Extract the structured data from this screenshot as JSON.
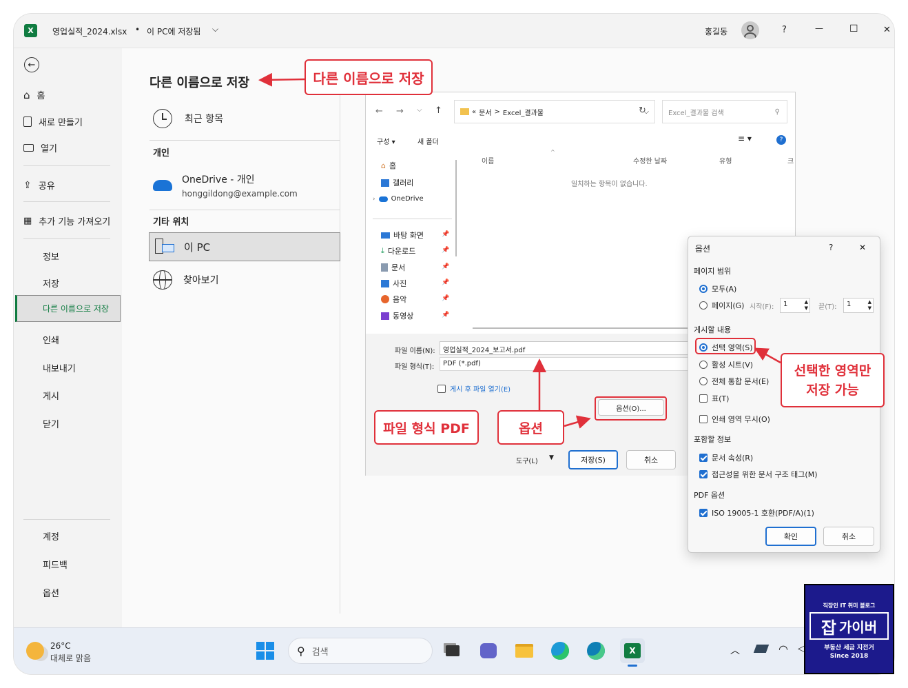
{
  "titlebar": {
    "filename": "영업실적_2024.xlsx",
    "bullet": "•",
    "save_location": "이 PC에 저장됨",
    "user": "홍길동",
    "help": "?",
    "minimize": "—",
    "maximize": "☐",
    "close": "✕"
  },
  "sidebar": {
    "items": [
      {
        "label": "홈"
      },
      {
        "label": "새로 만들기"
      },
      {
        "label": "열기"
      },
      {
        "label": "공유"
      },
      {
        "label": "추가 기능 가져오기"
      },
      {
        "label": "정보"
      },
      {
        "label": "저장"
      },
      {
        "label": "다른 이름으로 저장"
      },
      {
        "label": "인쇄"
      },
      {
        "label": "내보내기"
      },
      {
        "label": "게시"
      },
      {
        "label": "닫기"
      },
      {
        "label": "계정"
      },
      {
        "label": "피드백"
      },
      {
        "label": "옵션"
      }
    ]
  },
  "saveas": {
    "title": "다른 이름으로 저장",
    "recent": "최근 항목",
    "personal_header": "개인",
    "onedrive_name": "OneDrive - 개인",
    "onedrive_email": "honggildong@example.com",
    "other_header": "기타 위치",
    "this_pc": "이 PC",
    "browse": "찾아보기"
  },
  "dialog": {
    "path_prefix": "«",
    "path_part1": "문서",
    "path_sep": ">",
    "path_part2": "Excel_결과물",
    "search_placeholder": "Excel_결과물 검색",
    "organize": "구성 ▾",
    "new_folder": "새 폴더",
    "nav": {
      "home": "홈",
      "gallery": "갤러리",
      "onedrive": "OneDrive",
      "desktop": "바탕 화면",
      "downloads": "다운로드",
      "documents": "문서",
      "pictures": "사진",
      "music": "음악",
      "videos": "동영상"
    },
    "columns": {
      "name": "이름",
      "modified": "수정한 날짜",
      "type": "유형",
      "more": "크"
    },
    "empty_message": "일치하는 항목이 없습니다.",
    "filename_label": "파일 이름(N):",
    "filename_value": "영업실적_2024_보고서.pdf",
    "filetype_label": "파일 형식(T):",
    "filetype_value": "PDF (*.pdf)",
    "open_after": "게시 후 파일 열기(E)",
    "options_button": "옵션(O)...",
    "tools": "도구(L)",
    "save": "저장(S)",
    "cancel": "취소"
  },
  "options": {
    "title": "옵션",
    "help": "?",
    "close": "✕",
    "page_range_header": "페이지 범위",
    "all": "모두(A)",
    "pages": "페이지(G)",
    "from_label": "시작(F):",
    "from_value": "1",
    "to_label": "끝(T):",
    "to_value": "1",
    "publish_header": "게시할 내용",
    "selection": "선택 영역(S)",
    "active_sheets": "활성 시트(V)",
    "entire_workbook": "전체 통합 문서(E)",
    "table": "표(T)",
    "ignore_print_areas": "인쇄 영역 무시(O)",
    "include_header": "포함할 정보",
    "doc_properties": "문서 속성(R)",
    "accessibility_tags": "접근성을 위한 문서 구조 태그(M)",
    "pdf_header": "PDF 옵션",
    "iso": "ISO 19005-1 호환(PDF/A)(1)",
    "ok": "확인",
    "cancel": "취소"
  },
  "annotations": {
    "saveas_callout": "다른 이름으로 저장",
    "pdf_callout": "파일 형식 PDF",
    "options_callout": "옵션",
    "selection_callout_line1": "선택한 영역만",
    "selection_callout_line2": "저장 가능"
  },
  "taskbar": {
    "weather_temp": "26°C",
    "weather_desc": "대체로 맑음",
    "search_placeholder": "검색"
  },
  "watermark": {
    "line1": "직장인 IT 취미 블로그",
    "logo_char": "잡",
    "logo_text": "가이버",
    "line3": "부동산 세금 지전거",
    "line4": "Since 2018"
  },
  "colors": {
    "accent": "#1f6fd0",
    "callout_red": "#e0303a",
    "excel_green": "#107c41",
    "watermark_blue": "#1c1a8c"
  }
}
